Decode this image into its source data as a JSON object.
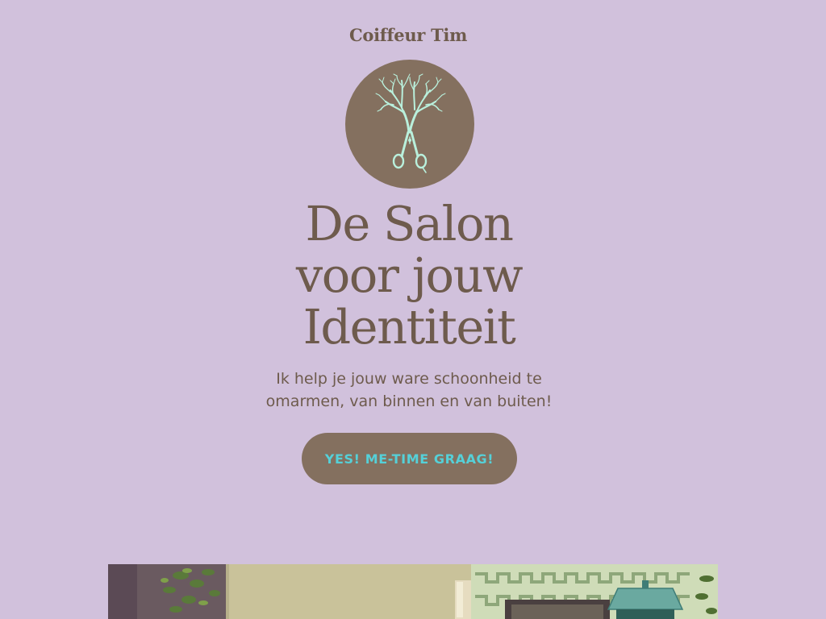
{
  "brand": {
    "name": "Coiffeur Tim",
    "logo_icon": "tree-scissors-icon"
  },
  "hero": {
    "heading_lines": [
      "De Salon",
      "voor jouw",
      "Identiteit"
    ],
    "subtitle_lines": [
      "Ik help je jouw ware schoonheid te",
      "omarmen, van binnen en van buiten!"
    ],
    "cta_label": "YES! ME-TIME GRAAG!"
  },
  "colors": {
    "background": "#d1c1dc",
    "brand_brown": "#84705f",
    "text_brown": "#6e5b4d",
    "accent_mint": "#b9f0dc",
    "cta_text": "#55d0d8"
  }
}
